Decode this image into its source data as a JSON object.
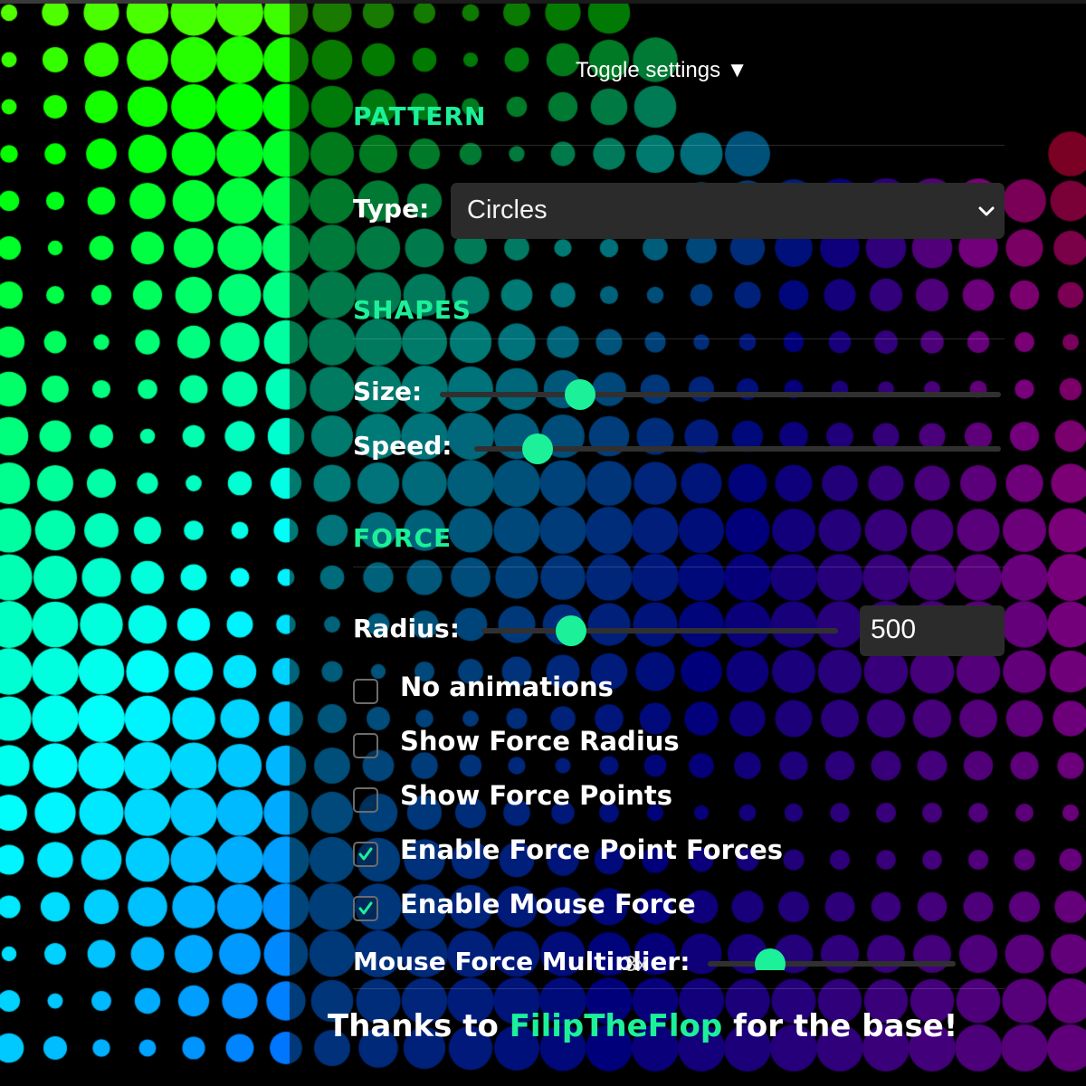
{
  "toggle": {
    "label": "Toggle settings ▼"
  },
  "sections": {
    "pattern": {
      "title": "PATTERN",
      "type_label": "Type:",
      "type_value": "Circles"
    },
    "shapes": {
      "title": "SHAPES",
      "size_label": "Size:",
      "speed_label": "Speed:"
    },
    "force": {
      "title": "FORCE",
      "radius_label": "Radius:",
      "radius_value": "500",
      "checkboxes": [
        {
          "label": "No animations",
          "checked": false
        },
        {
          "label": "Show Force Radius",
          "checked": false
        },
        {
          "label": "Show Force Points",
          "checked": false
        },
        {
          "label": "Enable Force Point Forces",
          "checked": true
        },
        {
          "label": "Enable Mouse Force",
          "checked": true
        }
      ],
      "mouse_multiplier_label": "Mouse Force Multiplier:",
      "mouse_multiplier_value": "3x"
    }
  },
  "credit": {
    "prefix": "Thanks to ",
    "link": "FilipTheFlop",
    "suffix": " for the base!"
  },
  "sliders": {
    "size": 0.25,
    "speed": 0.12,
    "radius": 0.25,
    "mouse_multiplier": 0.25
  },
  "colors": {
    "accent": "#1cf099",
    "panel": "#2b2b2b"
  }
}
